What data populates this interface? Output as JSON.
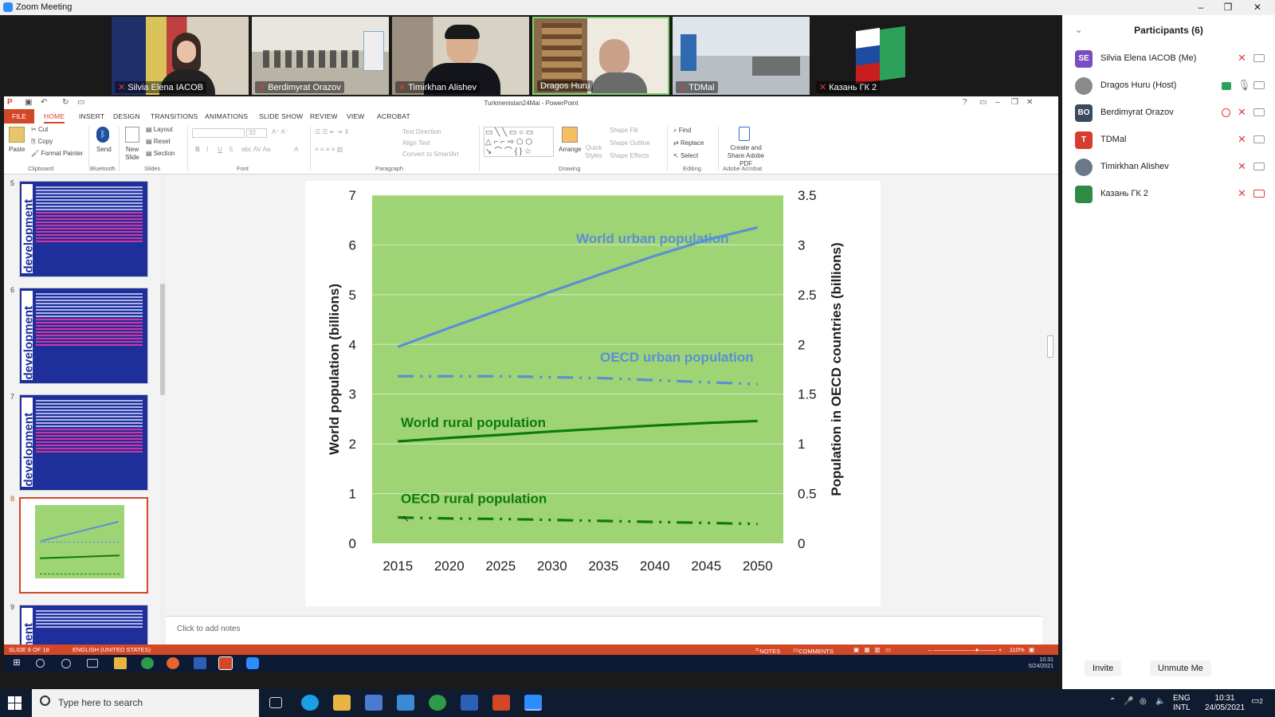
{
  "zoom": {
    "window_title": "Zoom Meeting",
    "window_buttons": [
      "–",
      "❐",
      "✕"
    ],
    "video_tiles": [
      {
        "name": "Silvia Elena IACOB"
      },
      {
        "name": "Berdimyrat Orazov"
      },
      {
        "name": "Timirkhan Alishev"
      },
      {
        "name": "Dragos Huru"
      },
      {
        "name": "TDMal"
      },
      {
        "name": "Казань ГК 2"
      }
    ],
    "participants_title": "Participants (6)",
    "participants": [
      {
        "initials": "SE",
        "name": "Silvia Elena IACOB (Me)",
        "color": "#7a4cc2"
      },
      {
        "initials": "",
        "name": "Dragos Huru (Host)",
        "color": "#8a8a8a"
      },
      {
        "initials": "BO",
        "name": "Berdimyrat Orazov",
        "color": "#3b4a5f"
      },
      {
        "initials": "T",
        "name": "TDMal",
        "color": "#d63c2f"
      },
      {
        "initials": "",
        "name": "Timirkhan Alishev",
        "color": "#6a7a8a"
      },
      {
        "initials": "",
        "name": "Казань ГК 2",
        "color": "#2f8a46"
      }
    ],
    "invite_label": "Invite",
    "unmute_label": "Unmute Me"
  },
  "powerpoint": {
    "doc_title": "Turkmenistan24Mai - PowerPoint",
    "tabs": [
      "FILE",
      "HOME",
      "INSERT",
      "DESIGN",
      "TRANSITIONS",
      "ANIMATIONS",
      "SLIDE SHOW",
      "REVIEW",
      "VIEW",
      "ACROBAT"
    ],
    "ribbon": {
      "paste": "Paste",
      "cut": "Cut",
      "copy": "Copy",
      "format_painter": "Format Painter",
      "send": "Send",
      "new_slide": "New Slide",
      "layout": "Layout",
      "reset": "Reset",
      "section": "Section",
      "font_size": "32",
      "text_direction": "Text Direction",
      "align_text": "Align Text",
      "convert_smartart": "Convert to SmartArt",
      "arrange": "Arrange",
      "quick_styles": "Quick Styles",
      "shape_fill": "Shape Fill",
      "shape_outline": "Shape Outline",
      "shape_effects": "Shape Effects",
      "find": "Find",
      "replace": "Replace",
      "select": "Select",
      "create_share": "Create and Share Adobe PDF",
      "groups": [
        "Clipboard",
        "Bluetooth",
        "Slides",
        "Font",
        "Paragraph",
        "Drawing",
        "Editing",
        "Adobe Acrobat"
      ]
    },
    "thumbnails": [
      {
        "num": "5",
        "side_text": "development"
      },
      {
        "num": "6",
        "side_text": "development"
      },
      {
        "num": "7",
        "side_text": "development"
      },
      {
        "num": "8",
        "side_text": ""
      },
      {
        "num": "9",
        "side_text": "development"
      }
    ],
    "notes_placeholder": "Click to add notes",
    "status": {
      "slide": "SLIDE 8 OF 18",
      "language": "ENGLISH (UNITED STATES)",
      "notes": "NOTES",
      "comments": "COMMENTS",
      "zoom": "110%"
    },
    "inner_clock": {
      "time": "10:31",
      "date": "5/24/2021"
    }
  },
  "chart_data": {
    "type": "line",
    "x": [
      2015,
      2020,
      2025,
      2030,
      2035,
      2040,
      2045,
      2050
    ],
    "left_axis": {
      "label": "World population (billions)",
      "ticks": [
        "0",
        "1",
        "2",
        "3",
        "4",
        "5",
        "6",
        "7"
      ],
      "ylim": [
        0,
        7
      ]
    },
    "right_axis": {
      "label": "Population in OECD countries (billions)",
      "ticks": [
        "0",
        "0.5",
        "1",
        "1.5",
        "2",
        "2.5",
        "3",
        "3.5"
      ],
      "ylim": [
        0,
        3.5
      ]
    },
    "series": [
      {
        "name": "World urban population",
        "axis": "left",
        "style": "solid",
        "color": "#5b8fd6",
        "values": [
          3.95,
          4.33,
          4.7,
          5.07,
          5.43,
          5.78,
          6.1,
          6.35
        ]
      },
      {
        "name": "OECD urban population",
        "axis": "right",
        "style": "dashed",
        "color": "#5b8fd6",
        "values": [
          1.68,
          1.68,
          1.68,
          1.67,
          1.66,
          1.64,
          1.62,
          1.6
        ]
      },
      {
        "name": "World rural population",
        "axis": "left",
        "style": "solid",
        "color": "#0d7a0d",
        "values": [
          2.05,
          2.12,
          2.18,
          2.25,
          2.31,
          2.37,
          2.42,
          2.46
        ]
      },
      {
        "name": "OECD rural population",
        "axis": "right",
        "style": "dashed",
        "color": "#0d7a0d",
        "values": [
          0.26,
          0.25,
          0.245,
          0.235,
          0.225,
          0.215,
          0.205,
          0.195
        ]
      }
    ],
    "plot_background": "#9fd474",
    "grid": true
  },
  "windows": {
    "search_placeholder": "Type here to search",
    "language": "ENG",
    "layout": "INTL",
    "time": "10:31",
    "date": "24/05/2021",
    "notification_count": "2"
  }
}
